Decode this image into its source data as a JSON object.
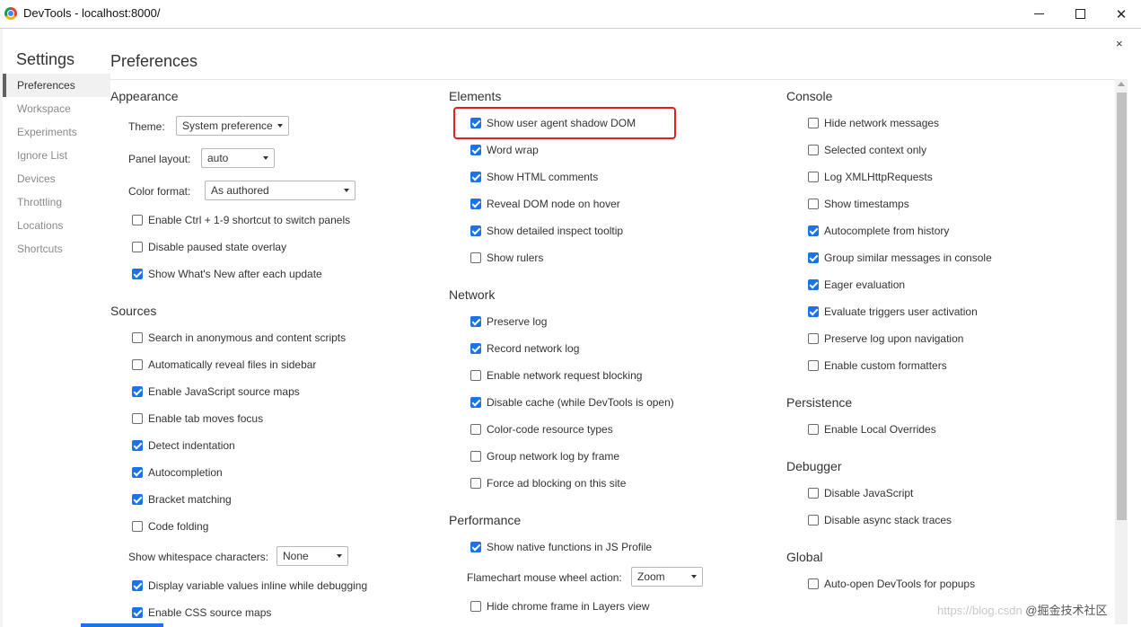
{
  "window": {
    "title": "DevTools - localhost:8000/",
    "minimize": "—",
    "maximize": "☐",
    "close": "✕"
  },
  "dialog": {
    "close": "×"
  },
  "sidebar": {
    "title": "Settings",
    "items": [
      {
        "label": "Preferences",
        "selected": true
      },
      {
        "label": "Workspace"
      },
      {
        "label": "Experiments"
      },
      {
        "label": "Ignore List"
      },
      {
        "label": "Devices"
      },
      {
        "label": "Throttling"
      },
      {
        "label": "Locations"
      },
      {
        "label": "Shortcuts"
      }
    ]
  },
  "page_title": "Preferences",
  "appearance": {
    "title": "Appearance",
    "theme_label": "Theme:",
    "theme_value": "System preference",
    "panel_layout_label": "Panel layout:",
    "panel_layout_value": "auto",
    "color_format_label": "Color format:",
    "color_format_value": "As authored",
    "options": [
      {
        "label": "Enable Ctrl + 1-9 shortcut to switch panels",
        "checked": false
      },
      {
        "label": "Disable paused state overlay",
        "checked": false
      },
      {
        "label": "Show What's New after each update",
        "checked": true
      }
    ]
  },
  "sources": {
    "title": "Sources",
    "options": [
      {
        "label": "Search in anonymous and content scripts",
        "checked": false
      },
      {
        "label": "Automatically reveal files in sidebar",
        "checked": false
      },
      {
        "label": "Enable JavaScript source maps",
        "checked": true
      },
      {
        "label": "Enable tab moves focus",
        "checked": false
      },
      {
        "label": "Detect indentation",
        "checked": true
      },
      {
        "label": "Autocompletion",
        "checked": true
      },
      {
        "label": "Bracket matching",
        "checked": true
      },
      {
        "label": "Code folding",
        "checked": false
      }
    ],
    "whitespace_label": "Show whitespace characters:",
    "whitespace_value": "None",
    "options2": [
      {
        "label": "Display variable values inline while debugging",
        "checked": true
      },
      {
        "label": "Enable CSS source maps",
        "checked": true
      }
    ]
  },
  "elements": {
    "title": "Elements",
    "options": [
      {
        "label": "Show user agent shadow DOM",
        "checked": true
      },
      {
        "label": "Word wrap",
        "checked": true
      },
      {
        "label": "Show HTML comments",
        "checked": true
      },
      {
        "label": "Reveal DOM node on hover",
        "checked": true
      },
      {
        "label": "Show detailed inspect tooltip",
        "checked": true
      },
      {
        "label": "Show rulers",
        "checked": false
      }
    ]
  },
  "network": {
    "title": "Network",
    "options": [
      {
        "label": "Preserve log",
        "checked": true
      },
      {
        "label": "Record network log",
        "checked": true
      },
      {
        "label": "Enable network request blocking",
        "checked": false
      },
      {
        "label": "Disable cache (while DevTools is open)",
        "checked": true
      },
      {
        "label": "Color-code resource types",
        "checked": false
      },
      {
        "label": "Group network log by frame",
        "checked": false
      },
      {
        "label": "Force ad blocking on this site",
        "checked": false
      }
    ]
  },
  "performance": {
    "title": "Performance",
    "options": [
      {
        "label": "Show native functions in JS Profile",
        "checked": true
      }
    ],
    "flamechart_label": "Flamechart mouse wheel action:",
    "flamechart_value": "Zoom",
    "options2": [
      {
        "label": "Hide chrome frame in Layers view",
        "checked": false
      }
    ]
  },
  "console": {
    "title": "Console",
    "options": [
      {
        "label": "Hide network messages",
        "checked": false
      },
      {
        "label": "Selected context only",
        "checked": false
      },
      {
        "label": "Log XMLHttpRequests",
        "checked": false
      },
      {
        "label": "Show timestamps",
        "checked": false
      },
      {
        "label": "Autocomplete from history",
        "checked": true
      },
      {
        "label": "Group similar messages in console",
        "checked": true
      },
      {
        "label": "Eager evaluation",
        "checked": true
      },
      {
        "label": "Evaluate triggers user activation",
        "checked": true
      },
      {
        "label": "Preserve log upon navigation",
        "checked": false
      },
      {
        "label": "Enable custom formatters",
        "checked": false
      }
    ]
  },
  "persistence": {
    "title": "Persistence",
    "options": [
      {
        "label": "Enable Local Overrides",
        "checked": false
      }
    ]
  },
  "debugger": {
    "title": "Debugger",
    "options": [
      {
        "label": "Disable JavaScript",
        "checked": false
      },
      {
        "label": "Disable async stack traces",
        "checked": false
      }
    ]
  },
  "global": {
    "title": "Global",
    "options": [
      {
        "label": "Auto-open DevTools for popups",
        "checked": false
      }
    ]
  },
  "watermark": {
    "url": "https://blog.csdn",
    "brand": "@掘金技术社区"
  },
  "colors": {
    "accent": "#1a73e8",
    "highlight": "#e0201a"
  }
}
